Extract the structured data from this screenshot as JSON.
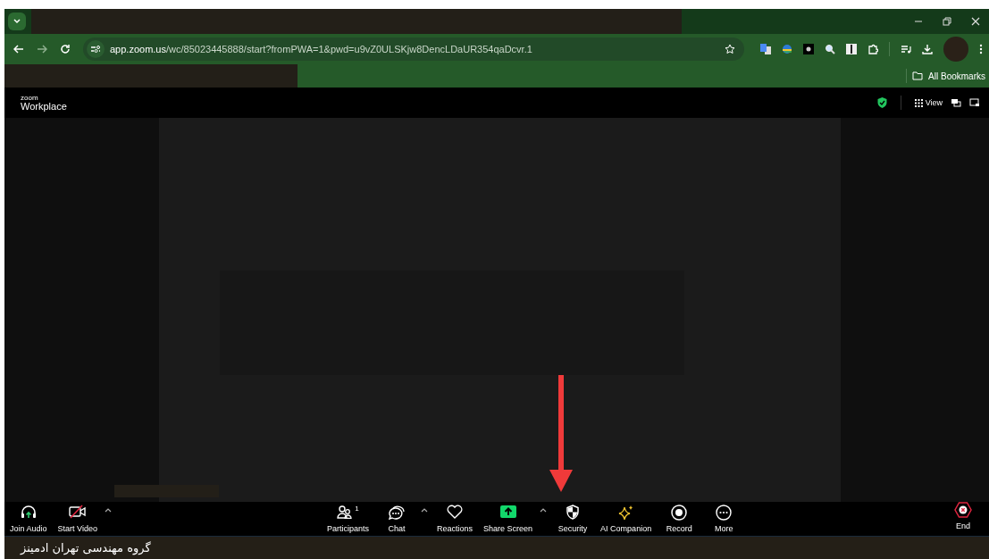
{
  "browser": {
    "url_host": "app.zoom.us",
    "url_path": "/wc/85023445888/start?fromPWA=1&pwd=u9vZ0ULSKjw8DencLDaUR354qaDcvr.1",
    "bookmarks_label": "All Bookmarks"
  },
  "meeting_header": {
    "brand_small": "zoom",
    "brand": "Workplace",
    "view_label": "View"
  },
  "toolbar": [
    {
      "kind": "audio",
      "label": "Join Audio",
      "has_menu": false
    },
    {
      "kind": "video",
      "label": "Start Video",
      "has_menu": true
    },
    {
      "kind": "participants",
      "label": "Participants",
      "count": "1",
      "has_menu": false
    },
    {
      "kind": "chat",
      "label": "Chat",
      "has_menu": true
    },
    {
      "kind": "reactions",
      "label": "Reactions",
      "has_menu": false
    },
    {
      "kind": "share",
      "label": "Share Screen",
      "has_menu": true
    },
    {
      "kind": "security",
      "label": "Security",
      "has_menu": false
    },
    {
      "kind": "ai",
      "label": "AI Companion",
      "has_menu": false
    },
    {
      "kind": "record",
      "label": "Record",
      "has_menu": false
    },
    {
      "kind": "more",
      "label": "More",
      "has_menu": false
    },
    {
      "kind": "end",
      "label": "End",
      "has_menu": false
    }
  ],
  "footer": {
    "text": "گروه مهندسی تهران ادمینز"
  }
}
